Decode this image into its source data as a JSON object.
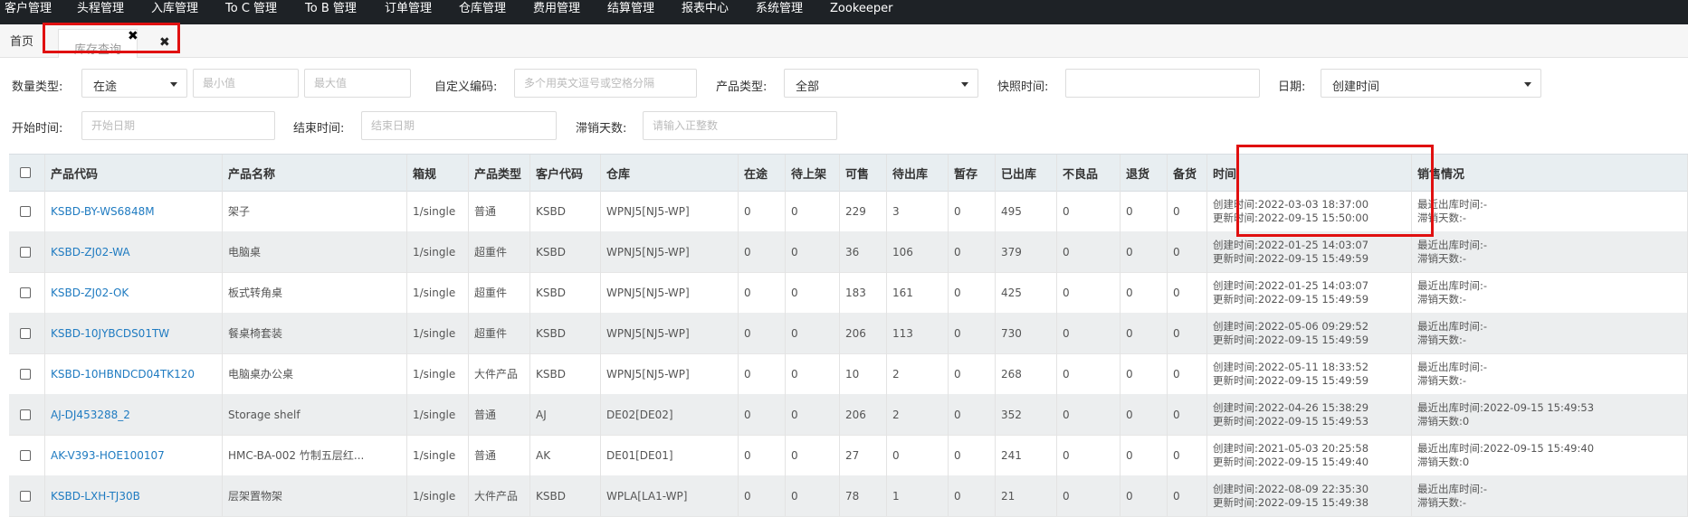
{
  "nav": [
    {
      "label": "客户管理",
      "name": "nav-customer"
    },
    {
      "label": "头程管理",
      "name": "nav-first-leg"
    },
    {
      "label": "入库管理",
      "name": "nav-inbound"
    },
    {
      "label": "To C 管理",
      "name": "nav-to-c"
    },
    {
      "label": "To B 管理",
      "name": "nav-to-b"
    },
    {
      "label": "订单管理",
      "name": "nav-order"
    },
    {
      "label": "仓库管理",
      "name": "nav-warehouse"
    },
    {
      "label": "费用管理",
      "name": "nav-fee"
    },
    {
      "label": "结算管理",
      "name": "nav-settlement"
    },
    {
      "label": "报表中心",
      "name": "nav-report"
    },
    {
      "label": "系统管理",
      "name": "nav-system"
    },
    {
      "label": "Zookeeper",
      "name": "nav-zookeeper"
    }
  ],
  "tabs": {
    "home": "首页",
    "active": "库存查询",
    "close_glyph": "✖"
  },
  "filters": {
    "qty_type_label": "数量类型:",
    "qty_type_value": "在途",
    "min_placeholder": "最小值",
    "max_placeholder": "最大值",
    "custom_code_label": "自定义编码:",
    "custom_code_placeholder": "多个用英文逗号或空格分隔",
    "product_type_label": "产品类型:",
    "product_type_value": "全部",
    "snapshot_label": "快照时间:",
    "date_label": "日期:",
    "date_value": "创建时间",
    "start_label": "开始时间:",
    "start_placeholder": "开始日期",
    "end_label": "结束时间:",
    "end_placeholder": "结束日期",
    "slow_label": "滞销天数:",
    "slow_placeholder": "请输入正整数"
  },
  "table": {
    "headers": {
      "code": "产品代码",
      "name": "产品名称",
      "box": "箱规",
      "ptype": "产品类型",
      "customer": "客户代码",
      "wh": "仓库",
      "transit": "在途",
      "pending_shelf": "待上架",
      "sellable": "可售",
      "pending_out": "待出库",
      "hold": "暂存",
      "shipped": "已出库",
      "defective": "不良品",
      "returned": "退货",
      "backup": "备货",
      "time": "时间",
      "sales": "销售情况"
    },
    "rows": [
      {
        "code": "KSBD-BY-WS6848M",
        "name": "架子",
        "box": "1/single",
        "ptype": "普通",
        "customer": "KSBD",
        "wh": "WPNJ5[NJ5-WP]",
        "transit": "0",
        "pending_shelf": "0",
        "sellable": "229",
        "pending_out": "3",
        "hold": "0",
        "shipped": "495",
        "defective": "0",
        "returned": "0",
        "backup": "0",
        "created": "创建时间:2022-03-03 18:37:00",
        "updated": "更新时间:2022-09-15 15:50:00",
        "last_out": "最近出库时间:-",
        "slow": "滞销天数:-"
      },
      {
        "code": "KSBD-ZJ02-WA",
        "name": "电脑桌",
        "box": "1/single",
        "ptype": "超重件",
        "customer": "KSBD",
        "wh": "WPNJ5[NJ5-WP]",
        "transit": "0",
        "pending_shelf": "0",
        "sellable": "36",
        "pending_out": "106",
        "hold": "0",
        "shipped": "379",
        "defective": "0",
        "returned": "0",
        "backup": "0",
        "created": "创建时间:2022-01-25 14:03:07",
        "updated": "更新时间:2022-09-15 15:49:59",
        "last_out": "最近出库时间:-",
        "slow": "滞销天数:-"
      },
      {
        "code": "KSBD-ZJ02-OK",
        "name": "板式转角桌",
        "box": "1/single",
        "ptype": "超重件",
        "customer": "KSBD",
        "wh": "WPNJ5[NJ5-WP]",
        "transit": "0",
        "pending_shelf": "0",
        "sellable": "183",
        "pending_out": "161",
        "hold": "0",
        "shipped": "425",
        "defective": "0",
        "returned": "0",
        "backup": "0",
        "created": "创建时间:2022-01-25 14:03:07",
        "updated": "更新时间:2022-09-15 15:49:59",
        "last_out": "最近出库时间:-",
        "slow": "滞销天数:-"
      },
      {
        "code": "KSBD-10JYBCDS01TW",
        "name": "餐桌椅套装",
        "box": "1/single",
        "ptype": "超重件",
        "customer": "KSBD",
        "wh": "WPNJ5[NJ5-WP]",
        "transit": "0",
        "pending_shelf": "0",
        "sellable": "206",
        "pending_out": "113",
        "hold": "0",
        "shipped": "730",
        "defective": "0",
        "returned": "0",
        "backup": "0",
        "created": "创建时间:2022-05-06 09:29:52",
        "updated": "更新时间:2022-09-15 15:49:59",
        "last_out": "最近出库时间:-",
        "slow": "滞销天数:-"
      },
      {
        "code": "KSBD-10HBNDCD04TK120",
        "name": "电脑桌办公桌",
        "box": "1/single",
        "ptype": "大件产品",
        "customer": "KSBD",
        "wh": "WPNJ5[NJ5-WP]",
        "transit": "0",
        "pending_shelf": "0",
        "sellable": "10",
        "pending_out": "2",
        "hold": "0",
        "shipped": "268",
        "defective": "0",
        "returned": "0",
        "backup": "0",
        "created": "创建时间:2022-05-11 18:33:52",
        "updated": "更新时间:2022-09-15 15:49:59",
        "last_out": "最近出库时间:-",
        "slow": "滞销天数:-"
      },
      {
        "code": "AJ-DJ453288_2",
        "name": "Storage shelf",
        "box": "1/single",
        "ptype": "普通",
        "customer": "AJ",
        "wh": "DE02[DE02]",
        "transit": "0",
        "pending_shelf": "0",
        "sellable": "206",
        "pending_out": "2",
        "hold": "0",
        "shipped": "352",
        "defective": "0",
        "returned": "0",
        "backup": "0",
        "created": "创建时间:2022-04-26 15:38:29",
        "updated": "更新时间:2022-09-15 15:49:53",
        "last_out": "最近出库时间:2022-09-15 15:49:53",
        "slow": "滞销天数:0"
      },
      {
        "code": "AK-V393-HOE100107",
        "name": "HMC-BA-002 竹制五层红...",
        "box": "1/single",
        "ptype": "普通",
        "customer": "AK",
        "wh": "DE01[DE01]",
        "transit": "0",
        "pending_shelf": "0",
        "sellable": "27",
        "pending_out": "0",
        "hold": "0",
        "shipped": "241",
        "defective": "0",
        "returned": "0",
        "backup": "0",
        "created": "创建时间:2021-05-03 20:25:58",
        "updated": "更新时间:2022-09-15 15:49:40",
        "last_out": "最近出库时间:2022-09-15 15:49:40",
        "slow": "滞销天数:0"
      },
      {
        "code": "KSBD-LXH-TJ30B",
        "name": "层架置物架",
        "box": "1/single",
        "ptype": "大件产品",
        "customer": "KSBD",
        "wh": "WPLA[LA1-WP]",
        "transit": "0",
        "pending_shelf": "0",
        "sellable": "78",
        "pending_out": "1",
        "hold": "0",
        "shipped": "21",
        "defective": "0",
        "returned": "0",
        "backup": "0",
        "created": "创建时间:2022-08-09 22:35:30",
        "updated": "更新时间:2022-09-15 15:49:38",
        "last_out": "最近出库时间:-",
        "slow": "滞销天数:-"
      }
    ]
  },
  "colors": {
    "nav_bg": "#1e2226",
    "link": "#1f7bc1",
    "highlight": "#e01010",
    "header_bg": "#e8eef1"
  }
}
